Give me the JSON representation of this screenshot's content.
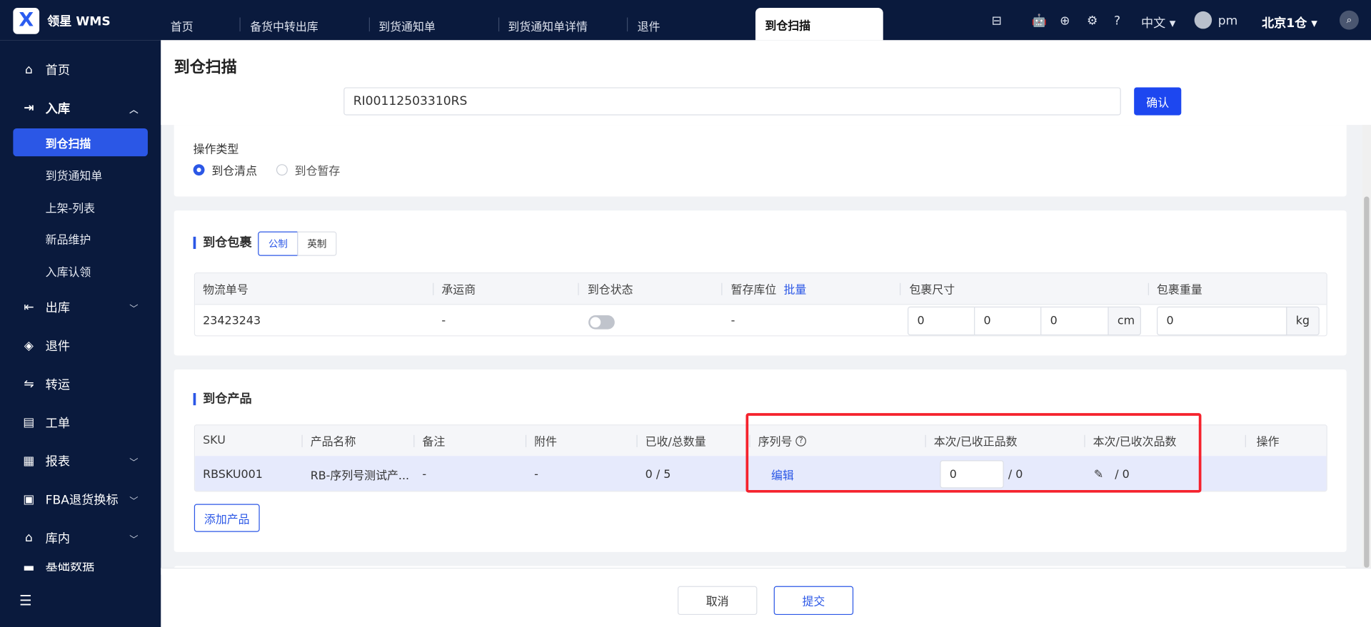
{
  "app": {
    "brand": "领星 WMS",
    "logo": "X"
  },
  "tabs": [
    "首页",
    "备货中转出库",
    "到货通知单",
    "到货通知单详情",
    "退件",
    "到仓扫描"
  ],
  "header_right": {
    "lang": "中文",
    "user": "pm",
    "warehouse": "北京1仓"
  },
  "sidebar": {
    "items": [
      {
        "label": "首页",
        "icon": "home-icon"
      },
      {
        "label": "入库",
        "icon": "inbound-icon"
      },
      {
        "label": "出库",
        "icon": "outbound-icon"
      },
      {
        "label": "退件",
        "icon": "return-icon"
      },
      {
        "label": "转运",
        "icon": "transfer-icon"
      },
      {
        "label": "工单",
        "icon": "workorder-icon"
      },
      {
        "label": "报表",
        "icon": "report-icon"
      },
      {
        "label": "FBA退货换标",
        "icon": "fba-icon"
      },
      {
        "label": "库内",
        "icon": "warehouse-icon"
      },
      {
        "label": "基础数据",
        "icon": "data-icon"
      }
    ],
    "sub": [
      "到仓扫描",
      "到货通知单",
      "上架-列表",
      "新品维护",
      "入库认领"
    ]
  },
  "page": {
    "title": "到仓扫描",
    "scan_value": "RI00112503310RS",
    "confirm": "确认"
  },
  "op": {
    "label": "操作类型",
    "options": [
      "到仓清点",
      "到仓暂存"
    ],
    "selected": 0
  },
  "pkg": {
    "title": "到仓包裹",
    "units": [
      "公制",
      "英制"
    ],
    "headers": [
      "物流单号",
      "承运商",
      "到仓状态",
      "暂存库位",
      "包裹尺寸",
      "包裹重量"
    ],
    "batch": "批量",
    "row": {
      "tracking": "23423243",
      "carrier": "-",
      "status_on": false,
      "location": "-",
      "l": "0",
      "w": "0",
      "h": "0",
      "dim_unit": "cm",
      "weight": "0",
      "weight_unit": "kg"
    }
  },
  "prod": {
    "title": "到仓产品",
    "headers": [
      "SKU",
      "产品名称",
      "备注",
      "附件",
      "已收/总数量",
      "序列号",
      "本次/已收正品数",
      "本次/已收次品数",
      "操作"
    ],
    "row": {
      "sku": "RBSKU001",
      "name": "RB-序列号测试产...",
      "remark": "-",
      "attach": "-",
      "qty": "0 / 5",
      "serial": "编辑",
      "good": "0",
      "good_total": "/ 0",
      "defect_total": "/ 0"
    },
    "add": "添加产品"
  },
  "footer": {
    "cancel": "取消",
    "submit": "提交"
  },
  "colors": {
    "accent": "#2b57e6",
    "nav": "#0a1a3d",
    "highlight": "#f5222d"
  }
}
